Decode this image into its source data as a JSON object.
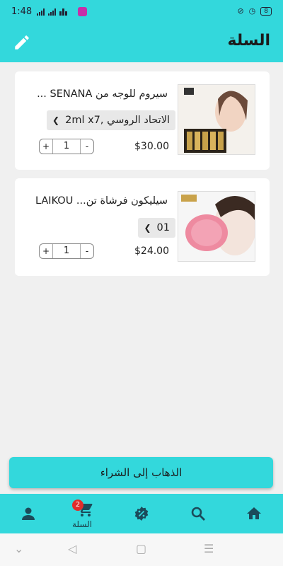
{
  "status_bar": {
    "time": "1:48",
    "battery": "8"
  },
  "header": {
    "title": "السلة"
  },
  "cart_items": [
    {
      "name": "سيروم للوجه من SENANA ...",
      "variant": "الاتحاد الروسي ,2ml x7",
      "quantity": "1",
      "price": "$30.00"
    },
    {
      "name": "سيليكون فرشاة تن... LAIKOU",
      "variant": "01",
      "quantity": "1",
      "price": "$24.00"
    }
  ],
  "stepper": {
    "plus": "+",
    "minus": "-"
  },
  "checkout": {
    "label": "الذهاب إلى الشراء"
  },
  "bottom_nav": {
    "cart_badge": "2",
    "cart_label": "السلة",
    "items": [
      "home-icon",
      "search-icon",
      "discount-icon",
      "cart-icon",
      "profile-icon"
    ]
  },
  "colors": {
    "accent": "#33d8dc",
    "badge": "#e02c2c",
    "card": "#ffffff",
    "background": "#f0f0f0"
  }
}
